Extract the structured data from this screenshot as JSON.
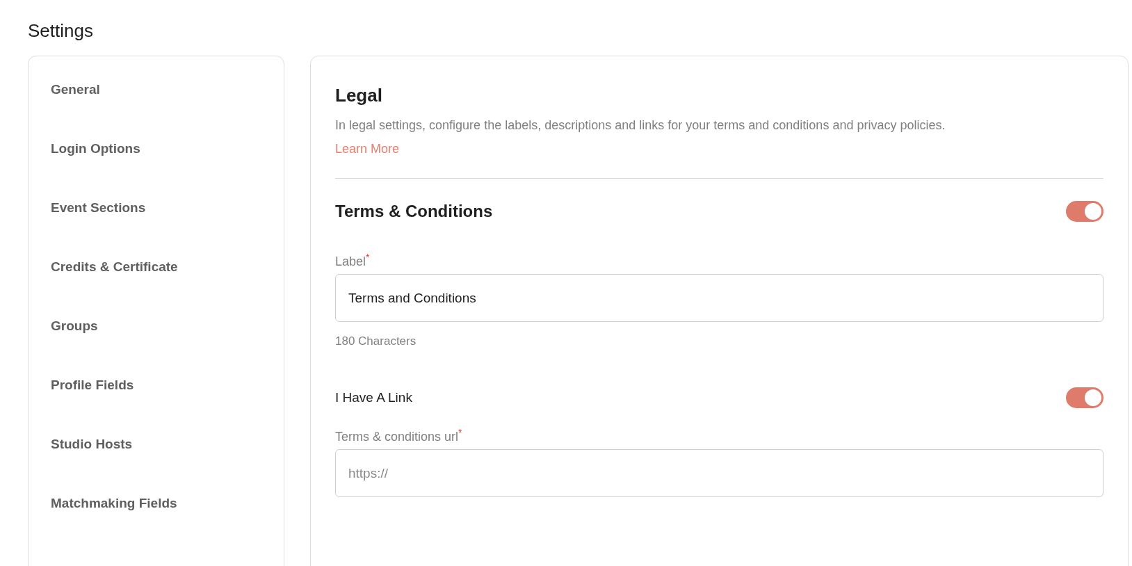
{
  "page_title": "Settings",
  "sidebar": {
    "items": [
      {
        "label": "General"
      },
      {
        "label": "Login Options"
      },
      {
        "label": "Event Sections"
      },
      {
        "label": "Credits & Certificate"
      },
      {
        "label": "Groups"
      },
      {
        "label": "Profile Fields"
      },
      {
        "label": "Studio Hosts"
      },
      {
        "label": "Matchmaking Fields"
      }
    ]
  },
  "panel": {
    "title": "Legal",
    "description": "In legal settings, configure the labels, descriptions and links for your terms and conditions and privacy policies.",
    "link": "Learn More",
    "section": {
      "title": "Terms & Conditions",
      "on": true
    },
    "label_field": {
      "label": "Label",
      "required_mark": "*",
      "value": "Terms and Conditions",
      "hint": "180 Characters"
    },
    "link_toggle": {
      "label": "I Have A Link",
      "on": true
    },
    "url_field": {
      "label": "Terms & conditions url",
      "required_mark": "*",
      "placeholder": "https://"
    }
  }
}
